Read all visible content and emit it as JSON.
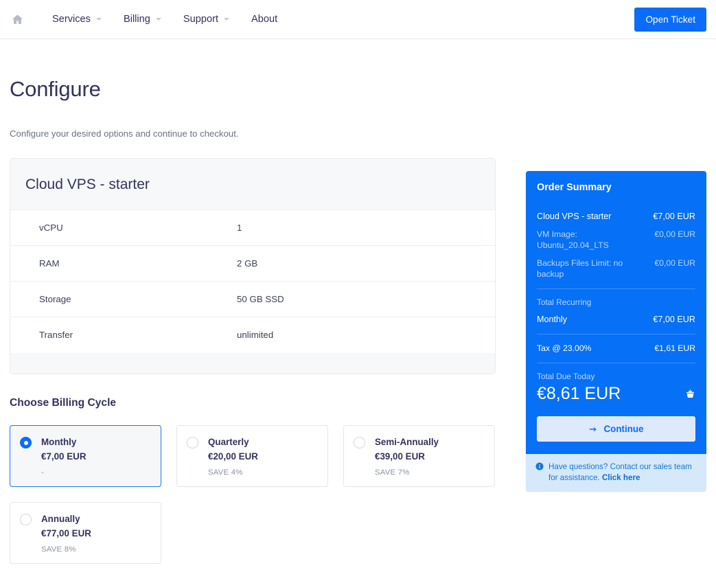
{
  "header": {
    "home_icon": "home-icon",
    "nav": [
      {
        "label": "Services",
        "has_dropdown": true
      },
      {
        "label": "Billing",
        "has_dropdown": true
      },
      {
        "label": "Support",
        "has_dropdown": true
      },
      {
        "label": "About",
        "has_dropdown": false
      }
    ],
    "open_ticket_label": "Open Ticket",
    "accent_color": "#0b6cf9"
  },
  "page": {
    "title": "Configure",
    "description": "Configure your desired options and continue to checkout."
  },
  "product": {
    "title": "Cloud VPS - starter",
    "specs": [
      {
        "name": "vCPU",
        "value": "1"
      },
      {
        "name": "RAM",
        "value": "2 GB"
      },
      {
        "name": "Storage",
        "value": "50 GB SSD"
      },
      {
        "name": "Transfer",
        "value": "unlimited"
      }
    ]
  },
  "billing_cycle": {
    "heading": "Choose Billing Cycle",
    "options": [
      {
        "label": "Monthly",
        "price": "€7,00 EUR",
        "save": "-",
        "selected": true
      },
      {
        "label": "Quarterly",
        "price": "€20,00 EUR",
        "save": "SAVE 4%",
        "selected": false
      },
      {
        "label": "Semi-Annually",
        "price": "€39,00 EUR",
        "save": "SAVE 7%",
        "selected": false
      },
      {
        "label": "Annually",
        "price": "€77,00 EUR",
        "save": "SAVE 8%",
        "selected": false
      }
    ]
  },
  "order_summary": {
    "title": "Order Summary",
    "panel_color": "#0670f6",
    "items": [
      {
        "label": "Cloud VPS - starter",
        "amount": "€7,00 EUR",
        "muted": false
      },
      {
        "label": "VM Image: Ubuntu_20.04_LTS",
        "amount": "€0,00 EUR",
        "muted": true
      },
      {
        "label": "Backups Files Limit: no backup",
        "amount": "€0,00 EUR",
        "muted": true
      }
    ],
    "recurring_caption": "Total Recurring",
    "recurring": {
      "label": "Monthly",
      "amount": "€7,00 EUR"
    },
    "tax": {
      "label": "Tax @ 23.00%",
      "amount": "€1,61 EUR"
    },
    "total_label": "Total Due Today",
    "total_amount": "€8,61 EUR",
    "cart_icon": "shopping-basket-icon",
    "continue_label": "Continue",
    "continue_icon": "arrow-right-icon",
    "footer": {
      "icon": "info-icon",
      "text": "Have questions? Contact our sales team for assistance.",
      "link_label": "Click here"
    }
  }
}
